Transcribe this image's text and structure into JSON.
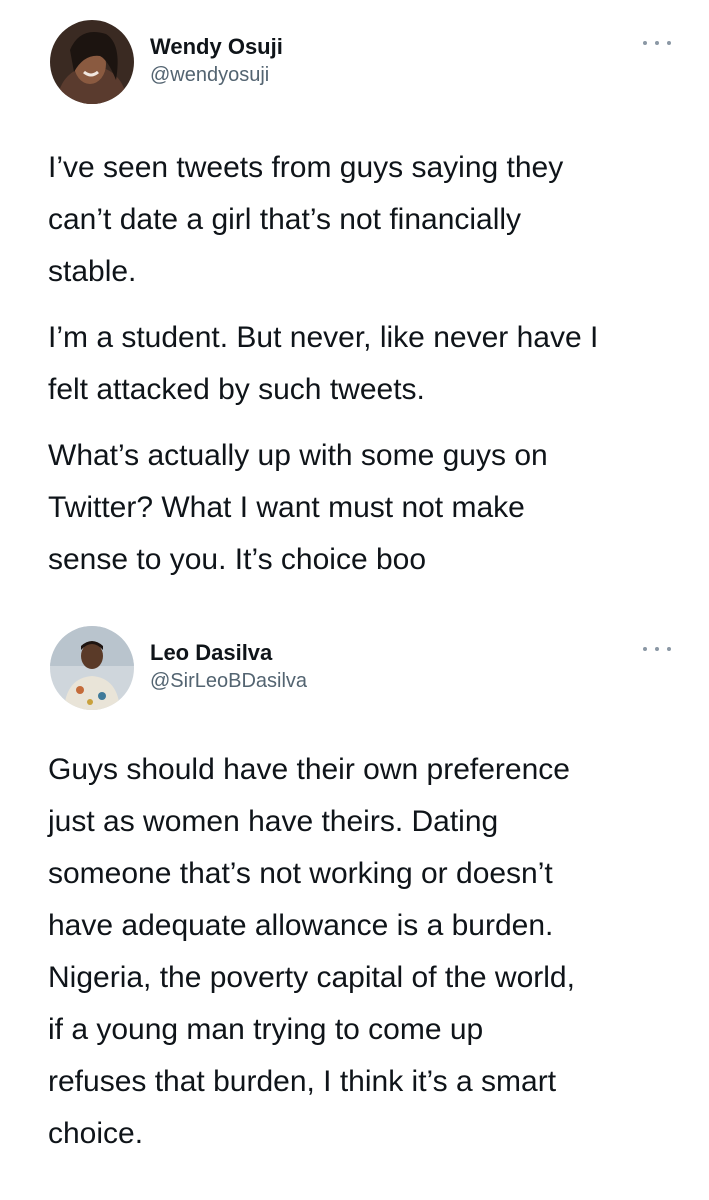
{
  "tweets": [
    {
      "author": {
        "name": "Wendy Osuji",
        "handle": "@wendyosuji"
      },
      "more_icon": "more-options-icon",
      "paragraphs": [
        [
          "I’ve seen tweets from guys saying they",
          "can’t date a girl that’s not financially",
          "stable."
        ],
        [
          "I’m a student. But never, like never have I",
          "felt attacked by such tweets."
        ],
        [
          "What’s actually up with some guys on",
          "Twitter? What I want must not make",
          "sense to you. It’s choice boo"
        ]
      ]
    },
    {
      "author": {
        "name": "Leo Dasilva",
        "handle": "@SirLeoBDasilva"
      },
      "more_icon": "more-options-icon",
      "paragraphs": [
        [
          "Guys should have their own preference",
          "just as women have theirs. Dating",
          "someone that’s not working or doesn’t",
          "have adequate allowance is a burden.",
          "Nigeria, the poverty capital of the world,",
          "if a young man trying to come up",
          "refuses that burden, I think it’s a smart",
          "choice."
        ]
      ]
    }
  ],
  "colors": {
    "text": "#0f1419",
    "secondary_text": "#536471",
    "icon": "#8b98a5",
    "background": "#ffffff"
  }
}
